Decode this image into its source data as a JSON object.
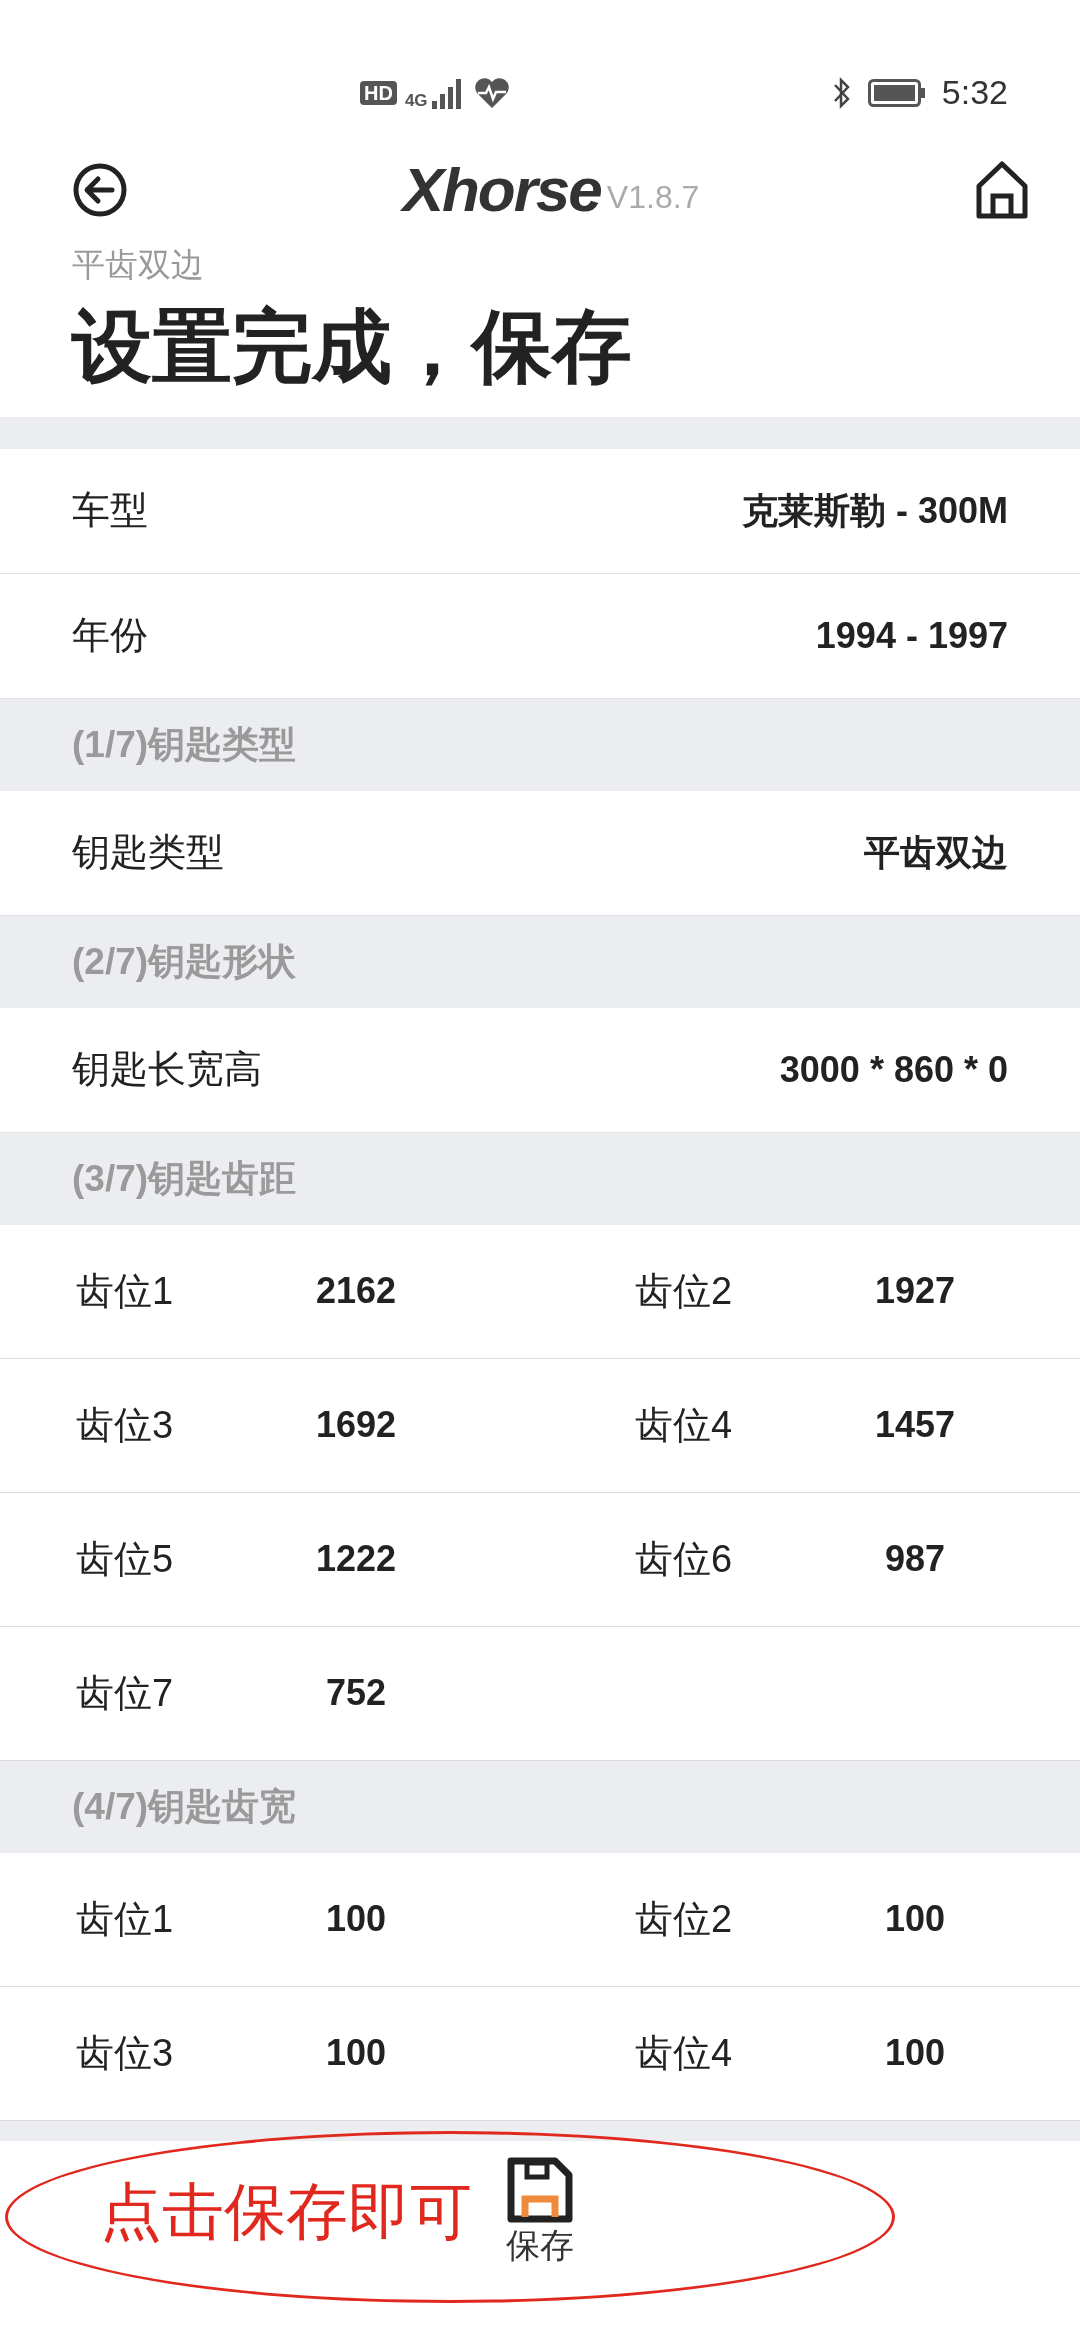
{
  "status_bar": {
    "hd_label": "HD",
    "network_label": "4G",
    "time": "5:32"
  },
  "header": {
    "logo": "Xhorse",
    "version": "V1.8.7"
  },
  "subtitle": "平齿双边",
  "title": "设置完成，保存",
  "items": [
    {
      "kind": "field",
      "label": "车型",
      "value": "克莱斯勒 - 300M"
    },
    {
      "kind": "field",
      "label": "年份",
      "value": "1994 - 1997"
    },
    {
      "kind": "section",
      "label": "(1/7)钥匙类型"
    },
    {
      "kind": "field",
      "label": "钥匙类型",
      "value": "平齿双边"
    },
    {
      "kind": "section",
      "label": "(2/7)钥匙形状"
    },
    {
      "kind": "field",
      "label": "钥匙长宽高",
      "value": "3000 * 860 * 0"
    },
    {
      "kind": "section",
      "label": "(3/7)钥匙齿距"
    },
    {
      "kind": "teeth",
      "rows": [
        [
          {
            "label": "齿位1",
            "value": "2162"
          },
          {
            "label": "齿位2",
            "value": "1927"
          }
        ],
        [
          {
            "label": "齿位3",
            "value": "1692"
          },
          {
            "label": "齿位4",
            "value": "1457"
          }
        ],
        [
          {
            "label": "齿位5",
            "value": "1222"
          },
          {
            "label": "齿位6",
            "value": "987"
          }
        ],
        [
          {
            "label": "齿位7",
            "value": "752"
          }
        ]
      ]
    },
    {
      "kind": "section",
      "label": "(4/7)钥匙齿宽"
    },
    {
      "kind": "teeth",
      "rows": [
        [
          {
            "label": "齿位1",
            "value": "100"
          },
          {
            "label": "齿位2",
            "value": "100"
          }
        ],
        [
          {
            "label": "齿位3",
            "value": "100"
          },
          {
            "label": "齿位4",
            "value": "100"
          }
        ]
      ]
    }
  ],
  "bottom_bar": {
    "save_label": "保存"
  },
  "annotation": {
    "text": "点击保存即可"
  }
}
